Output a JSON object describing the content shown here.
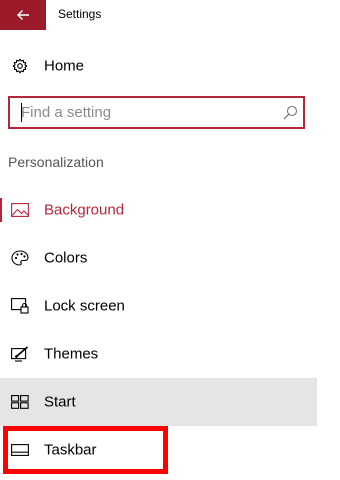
{
  "window": {
    "title": "Settings"
  },
  "nav": {
    "home": {
      "label": "Home",
      "icon": "gear-icon"
    }
  },
  "search": {
    "placeholder": "Find a setting",
    "value": ""
  },
  "section": {
    "title": "Personalization"
  },
  "sidebar": {
    "items": [
      {
        "label": "Background",
        "icon": "picture-icon",
        "selected": true
      },
      {
        "label": "Colors",
        "icon": "palette-icon"
      },
      {
        "label": "Lock screen",
        "icon": "lock-screen-icon"
      },
      {
        "label": "Themes",
        "icon": "themes-icon"
      },
      {
        "label": "Start",
        "icon": "start-icon",
        "hovered": true
      },
      {
        "label": "Taskbar",
        "icon": "taskbar-icon"
      }
    ]
  },
  "colors": {
    "accent": "#b4273a",
    "back_button": "#9b1b2b",
    "hover_row": "#e5e5e5",
    "annotation": "#ff0000"
  }
}
